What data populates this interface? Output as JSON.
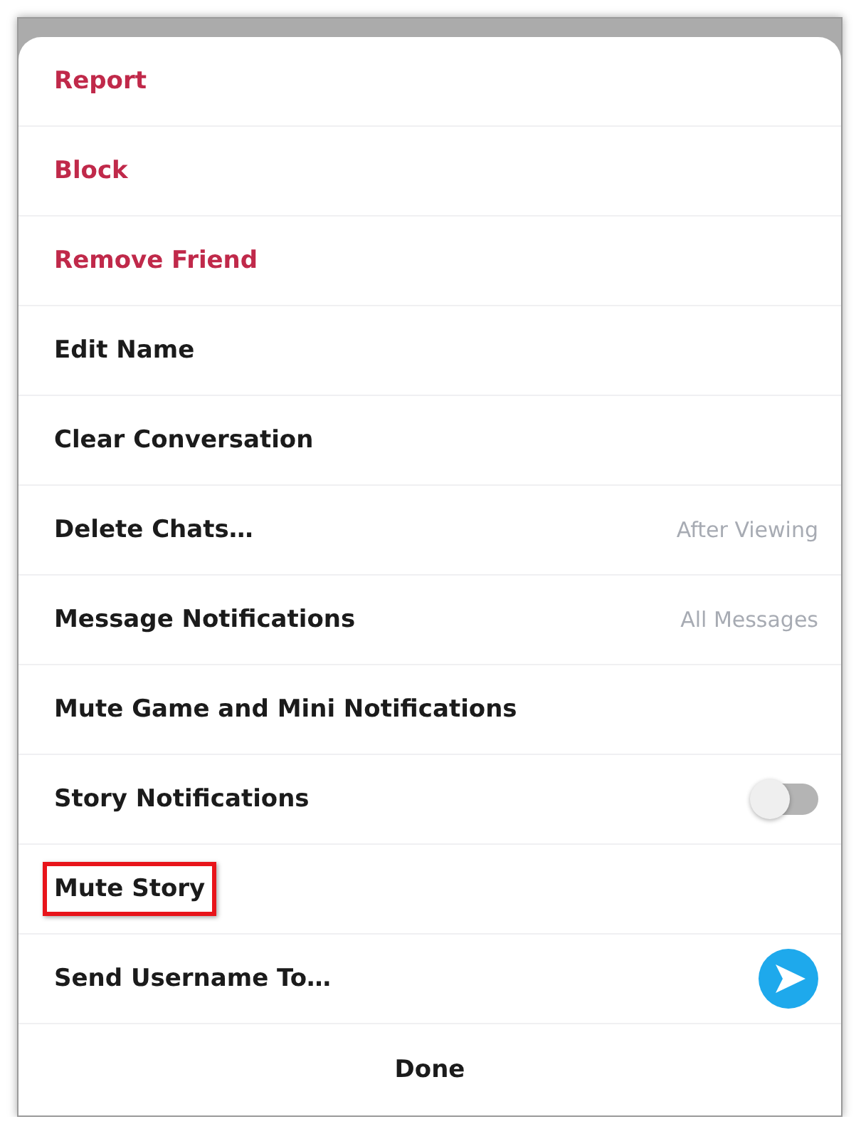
{
  "items": [
    {
      "label": "Report",
      "kind": "plain",
      "destructive": true,
      "highlighted": false
    },
    {
      "label": "Block",
      "kind": "plain",
      "destructive": true,
      "highlighted": false
    },
    {
      "label": "Remove Friend",
      "kind": "plain",
      "destructive": true,
      "highlighted": false
    },
    {
      "label": "Edit Name",
      "kind": "plain",
      "destructive": false,
      "highlighted": false
    },
    {
      "label": "Clear Conversation",
      "kind": "plain",
      "destructive": false,
      "highlighted": false
    },
    {
      "label": "Delete Chats…",
      "kind": "value",
      "value": "After Viewing",
      "destructive": false,
      "highlighted": false
    },
    {
      "label": "Message Notifications",
      "kind": "value",
      "value": "All Messages",
      "destructive": false,
      "highlighted": false
    },
    {
      "label": "Mute Game and Mini Notifications",
      "kind": "plain",
      "destructive": false,
      "highlighted": false
    },
    {
      "label": "Story Notifications",
      "kind": "toggle",
      "on": false,
      "destructive": false,
      "highlighted": false
    },
    {
      "label": "Mute Story",
      "kind": "plain",
      "destructive": false,
      "highlighted": true
    },
    {
      "label": "Send Username To…",
      "kind": "send",
      "destructive": false,
      "highlighted": false
    }
  ],
  "done": "Done"
}
